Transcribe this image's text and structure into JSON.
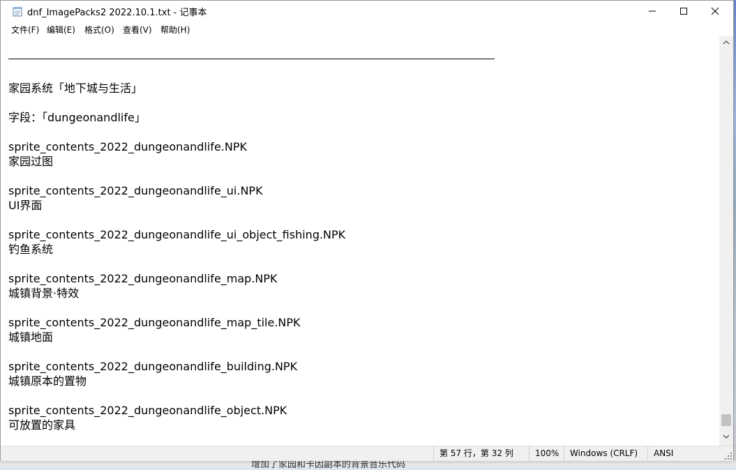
{
  "window": {
    "title": "dnf_ImagePacks2 2022.10.1.txt - 记事本"
  },
  "menu": {
    "items": [
      "文件(F)",
      "编辑(E)",
      "格式(O)",
      "查看(V)",
      "帮助(H)"
    ]
  },
  "content": {
    "lines": [
      "家园系统「地下城与生活」",
      "字段：「dungeonandlife」",
      "sprite_contents_2022_dungeonandlife.NPK",
      "家园过图",
      "sprite_contents_2022_dungeonandlife_ui.NPK",
      "UI界面",
      "sprite_contents_2022_dungeonandlife_ui_object_fishing.NPK",
      "钓鱼系统",
      "sprite_contents_2022_dungeonandlife_map.NPK",
      "城镇背景·特效",
      "sprite_contents_2022_dungeonandlife_map_tile.NPK",
      "城镇地面",
      "sprite_contents_2022_dungeonandlife_building.NPK",
      "城镇原本的置物",
      "sprite_contents_2022_dungeonandlife_object.NPK",
      "可放置的家具"
    ]
  },
  "status": {
    "position": "第 57 行，第 32 列",
    "zoom": "100%",
    "line_ending": "Windows (CRLF)",
    "encoding": "ANSI"
  },
  "background": {
    "bottom_text": "增加了家园和卡因副本的背景音乐代码"
  }
}
